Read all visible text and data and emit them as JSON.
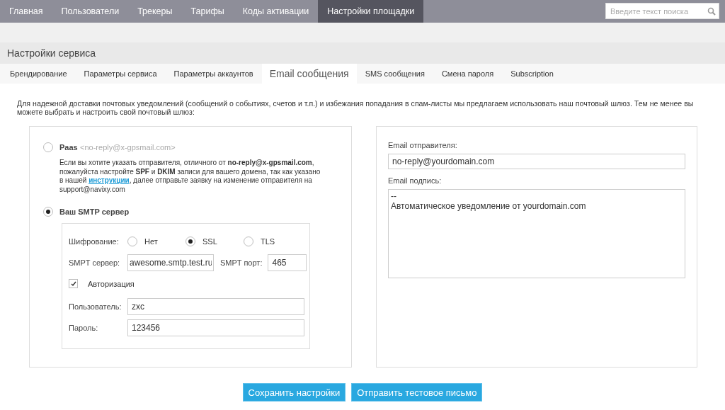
{
  "nav": {
    "items": [
      {
        "label": "Главная",
        "selected": false
      },
      {
        "label": "Пользователи",
        "selected": false
      },
      {
        "label": "Трекеры",
        "selected": false
      },
      {
        "label": "Тарифы",
        "selected": false
      },
      {
        "label": "Коды активации",
        "selected": false
      },
      {
        "label": "Настройки площадки",
        "selected": true
      }
    ],
    "search": {
      "placeholder": "Введите текст поиска"
    }
  },
  "page_title": "Настройки сервиса",
  "tabs": [
    {
      "label": "Брендирование",
      "selected": false
    },
    {
      "label": "Параметры сервиса",
      "selected": false
    },
    {
      "label": "Параметры аккаунтов",
      "selected": false
    },
    {
      "label": "Email сообщения",
      "selected": true
    },
    {
      "label": "SMS сообщения",
      "selected": false
    },
    {
      "label": "Смена пароля",
      "selected": false
    },
    {
      "label": "Subscription",
      "selected": false
    }
  ],
  "intro": "Для надежной доставки почтовых уведомлений (сообщений о событиях, счетов и т.п.) и избежания попадания в спам-листы мы предлагаем использовать наш почтовый шлюз. Тем не менее вы можете выбрать и настроить свой почтовый шлюз:",
  "gateway": {
    "options": [
      {
        "kind": "paas",
        "label": "Paas",
        "address": "<no-reply@x-gpsmail.com>",
        "selected": false,
        "description_before": "Если вы хотите указать отправителя, отличного от **no-reply@x-gpsmail.com**, пожалуйста настройте **SPF** и **DKIM** записи для вашего домена, так как указано в нашей ",
        "description_link": "инструкции",
        "description_after": ", далее отправьте заявку на изменение отправителя на support@navixy.com"
      },
      {
        "kind": "smtp",
        "label": "Ваш SMTP сервер",
        "selected": true
      }
    ],
    "smtp": {
      "encryption": {
        "label": "Шифрование:",
        "options": [
          {
            "label": "Нет",
            "selected": false
          },
          {
            "label": "SSL",
            "selected": true
          },
          {
            "label": "TLS",
            "selected": false
          }
        ]
      },
      "server": {
        "label": "SMPT сервер:",
        "value": "awesome.smtp.test.ru"
      },
      "port": {
        "label": "SMPT порт:",
        "value": "465"
      },
      "auth": {
        "label": "Авторизация",
        "checked": true
      },
      "user": {
        "label": "Пользователь:",
        "value": "zxc"
      },
      "password": {
        "label": "Пароль:",
        "value": "123456"
      }
    }
  },
  "sender": {
    "email": {
      "label": "Email отправителя:",
      "value": "no-reply@yourdomain.com"
    },
    "signature": {
      "label": "Email подпись:",
      "value": "--\nАвтоматическое уведомление от yourdomain.com"
    }
  },
  "buttons": [
    {
      "label": "Сохранить настройки"
    },
    {
      "label": "Отправить тестовое письмо"
    }
  ]
}
